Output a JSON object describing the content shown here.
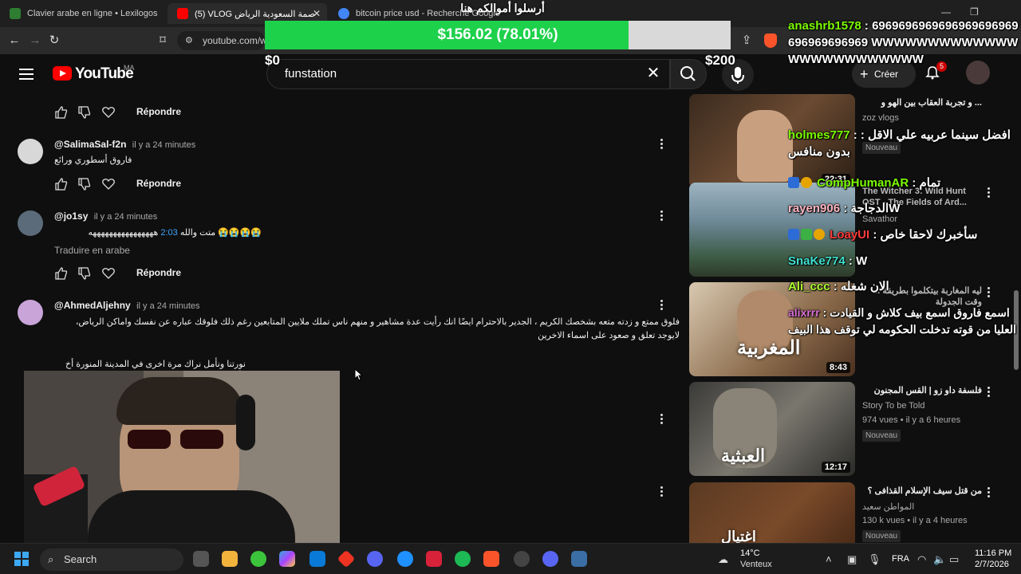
{
  "browser": {
    "tabs": [
      {
        "title": "Clavier arabe en ligne • Lexilogos",
        "favicon_color": "#2e7d32"
      },
      {
        "title": "(5) VLOG عاصمة السعودية الرياض",
        "favicon_color": "#ff0000"
      },
      {
        "title": "bitcoin price usd - Recherche Google",
        "favicon_color": "#4285f4"
      }
    ],
    "url": "youtube.com/w"
  },
  "donation": {
    "title": "أرسلوا أموالكم هنا",
    "amount_label": "$156.02 (78.01%)",
    "min_label": "$0",
    "max_label": "$200",
    "progress": 0.7801
  },
  "youtube": {
    "logo_text": "YouTube",
    "region": "MA",
    "search_value": "funstation",
    "create_label": "Créer",
    "notifications": "5"
  },
  "comments": [
    {
      "author": "@SalimaSal-f2n",
      "time": "il y a 24 minutes",
      "text": "فاروق أسطوري ورائع",
      "reply_label": "Répondre",
      "avatar_color": "#d8d8d8"
    },
    {
      "author": "@jo1sy",
      "time": "il y a 24 minutes",
      "text_prefix": "😭😭😭😭 متت والله ",
      "timestamp_link": "2:03",
      "text_suffix": " ههههههههههههههههه",
      "translate_label": "Traduire en arabe",
      "reply_label": "Répondre",
      "avatar_color": "#5b6b7a"
    },
    {
      "author": "@AhmedAljehny",
      "time": "il y a 24 minutes",
      "text": "فلوق ممتع و زدته متعه بشخصك الكريم ، الجدير بالاحترام ايضًا انك رأيت عدة مشاهير و منهم ناس تملك ملايين المتابعين رغم ذلك فلوقك عباره عن نفسك واماكن الرياض، لايوجد تعلق و صعود على اسماء الاخرين",
      "text2": "نورتنا ونأمل نراك مرة اخرى في المدينة المنورة أخ فاروق.",
      "avatar_color": "#c8a4d8"
    }
  ],
  "sidebar_videos": [
    {
      "title": "... و تجربة العقاب بين الهو و",
      "channel": "zoz vlogs",
      "meta": "",
      "badge": "Nouveau",
      "duration": "22:31",
      "thumb_color": "#6a4a32"
    },
    {
      "title": "The Witcher 3: Wild Hunt OST - The Fields of Ard...",
      "channel": "Savathor",
      "meta": "",
      "badge": "",
      "duration": "",
      "thumb_color": "#6f8a99"
    },
    {
      "title": "ليه المغاربة بيتكلموا بطريقة ... وقت الجدولة",
      "channel": "",
      "meta": "",
      "badge": "",
      "duration": "8:43",
      "thumb_color": "#8a6a4a",
      "thumb_text": "المغربية"
    },
    {
      "title": "فلسفة داو زو | القس المجنون",
      "channel": "Story To be Told",
      "meta": "974 vues • il y a 6 heures",
      "badge": "Nouveau",
      "duration": "12:17",
      "thumb_color": "#5d5a52",
      "thumb_text": "العبثية"
    },
    {
      "title": "من قتل سيف الإسلام القذافى ؟",
      "channel": "المواطن سعيد",
      "meta": "130 k vues • il y a 4 heures",
      "badge": "Nouveau",
      "duration": "",
      "thumb_color": "#7a4a2a",
      "thumb_text": "اغتيال"
    }
  ],
  "chat": [
    {
      "user": "anashrb1578",
      "user_color": "#ffffff",
      "message": "6969696969696969696969696969696969 WWWWWWWWWWWWWWWWWWWWWWWWW"
    },
    {
      "user": "holmes777",
      "user_color": "#ffffff",
      "message": "افضل سينما عربيه علي الاقل : بدون منافس"
    },
    {
      "user": "CompHumanAR",
      "user_color": "#7CFC00",
      "message": "تمام"
    },
    {
      "user": "rayen906",
      "user_color": "#ffb6c1",
      "message": "الدجاجةW"
    },
    {
      "user": "LoayUI",
      "user_color": "#ff3b3b",
      "message": "سأخبرك لاحقا خاص"
    },
    {
      "user": "SnaKe774",
      "user_color": "#40e0d0",
      "message": "W"
    },
    {
      "user": "Ali_ccc",
      "user_color": "#adff2f",
      "message": "الان شغله"
    },
    {
      "user": "alixrrr",
      "user_color": "#da70d6",
      "message": "اسمع فاروق اسمع بيف كلاش و القيادت العليا من قوته تدخلت الحكومه لي توقف هذا البيف"
    }
  ],
  "taskbar": {
    "search_label": "Search",
    "weather_temp": "14°C",
    "weather_desc": "Venteux",
    "language": "FRA",
    "time": "11:16 PM",
    "date": "2/7/2026"
  }
}
